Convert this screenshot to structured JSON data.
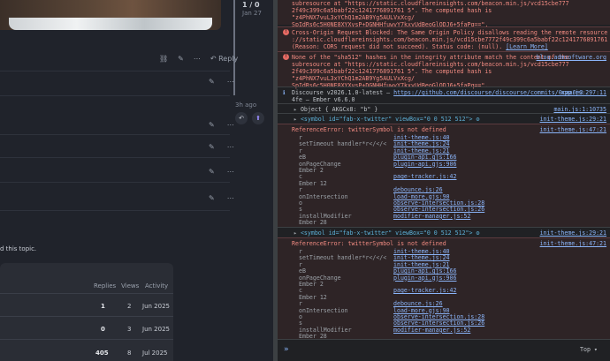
{
  "forum": {
    "timeline_position": "1 / 0",
    "timeline_date": "Jan 27",
    "timeline_ago": "3h ago",
    "reply_label": "Reply",
    "suggested_text": "d this topic.",
    "table": {
      "headers": [
        "Replies",
        "Views",
        "Activity"
      ],
      "rows": [
        {
          "replies": "1",
          "views": "2",
          "activity": "Jun 2025"
        },
        {
          "replies": "0",
          "views": "3",
          "activity": "Jun 2025"
        },
        {
          "replies": "405",
          "views": "8",
          "activity": "Jul 2025"
        }
      ]
    }
  },
  "devtools": {
    "err1_lines": [
      "subresource at \"https://static.cloudflareinsights.com/beacon.min.js/vcd15cbe777",
      "2f49c399c6a5babf22c1241776891761 5\". The computed hash is",
      "\"z4PhNX7vuL3xYChQ1m2AB9Yg5AULVxXcg/",
      "SpIdRs6c5H0NE8XYXvsP+DGNHHfuwvY7kxvUdBeoGlODJ6+5faPq==\"."
    ],
    "err2_lines": [
      "Cross-Origin Request Blocked: The Same Origin Policy disallows reading the remote resource at https",
      "://static.cloudflareinsights.com/beacon.min.js/vcd15cbe7772f49c399c6a5babf22c1241776891761 5.",
      "(Reason: CORS request did not succeed). Status code: (null)."
    ],
    "err2_learn_more": "[Learn More]",
    "err3_lines": [
      "None of the \"sha512\" hashes in the integrity attribute match the content of the",
      "subresource at \"https://static.cloudflareinsights.com/beacon.min.js/vcd15cbe777",
      "2f49c399c6a5babf22c1241776891761 5\". The computed hash is",
      "\"z4PhNX7vuL3xYChQ1m2AB9Yg5AULVxXcg/",
      "SpIdRs6c5H0NE8XYXvsP+DGNHHfuwvY7kxvUdBeoGlODJ6+5faPq==\"."
    ],
    "err3_source": "blog.admsoftware.org",
    "discourse_info": "Discourse v2026.1.0-latest — ",
    "discourse_link": "https://github.com/discourse/discourse/commits/0caa6e3",
    "discourse_info2": "4fe — Ember v6.6.0",
    "discourse_source": "app.js:297:11",
    "object_line": "Object { AKGCx8: \"b\" }",
    "object_source": "main.js:1:10735",
    "symbol_line": "<symbol id=\"fab-x-twitter\" viewBox=\"0 0 512 512\"> ",
    "symbol_source": "init-theme.js:29:21",
    "refErr": "ReferenceError: twitterSymbol is not defined",
    "refErr_source": "init-theme.js:47:21",
    "stack1": [
      {
        "fn": "r",
        "src": "init-theme.js:40"
      },
      {
        "fn": "setTimeout handler*r</</<",
        "src": "init-theme.js:24"
      },
      {
        "fn": "r",
        "src": "init-theme.js:21"
      },
      {
        "fn": "eB",
        "src": "plugin-api.gjs:166"
      },
      {
        "fn": "onPageChange",
        "src": "plugin-api.gjs:906"
      },
      {
        "fn": "Ember 2",
        "src": ""
      },
      {
        "fn": "c",
        "src": "page-tracker.js:42"
      },
      {
        "fn": "Ember 12",
        "src": ""
      },
      {
        "fn": "r",
        "src": "debounce.js:26"
      },
      {
        "fn": "onIntersection",
        "src": "load-more.gjs:90"
      },
      {
        "fn": "o",
        "src": "observe-intersection.js:28"
      },
      {
        "fn": "s",
        "src": "observe-intersection.js:26"
      },
      {
        "fn": "installModifier",
        "src": "modifier-manager.js:52"
      },
      {
        "fn": "Ember 28",
        "src": ""
      }
    ],
    "footer_level": "Top"
  }
}
